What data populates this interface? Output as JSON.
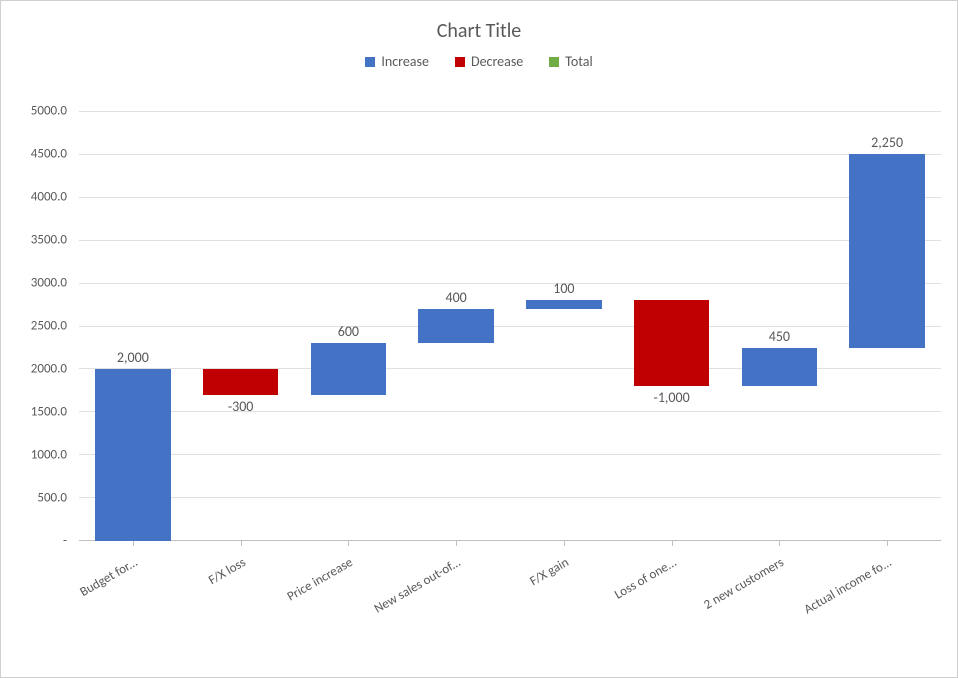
{
  "chart_data": {
    "type": "waterfall",
    "title": "Chart Title",
    "legend": [
      {
        "name": "Increase",
        "color": "#4472C4"
      },
      {
        "name": "Decrease",
        "color": "#C00000"
      },
      {
        "name": "Total",
        "color": "#70AD47"
      }
    ],
    "categories": [
      "Budget for...",
      "F/X loss",
      "Price increase",
      "New sales out-of...",
      "F/X gain",
      "Loss of one...",
      "2 new customers",
      "Actual income fo..."
    ],
    "data_labels": [
      "2,000",
      "-300",
      "600",
      "400",
      "100",
      "-1,000",
      "450",
      "2,250"
    ],
    "values": [
      2000,
      -300,
      600,
      400,
      100,
      -1000,
      450,
      2250
    ],
    "y_ticks": [
      "-",
      "500.0",
      "1000.0",
      "1500.0",
      "2000.0",
      "2500.0",
      "3000.0",
      "3500.0",
      "4000.0",
      "4500.0",
      "5000.0"
    ],
    "ylim": [
      0,
      5000
    ],
    "bars": [
      {
        "bottom": 0,
        "top": 2000,
        "class": "increase",
        "label_pos": "top"
      },
      {
        "bottom": 1700,
        "top": 2000,
        "class": "decrease",
        "label_pos": "bottom"
      },
      {
        "bottom": 1700,
        "top": 2300,
        "class": "increase",
        "label_pos": "top"
      },
      {
        "bottom": 2300,
        "top": 2700,
        "class": "increase",
        "label_pos": "top"
      },
      {
        "bottom": 2700,
        "top": 2800,
        "class": "increase",
        "label_pos": "top"
      },
      {
        "bottom": 1800,
        "top": 2800,
        "class": "decrease",
        "label_pos": "bottom"
      },
      {
        "bottom": 1800,
        "top": 2250,
        "class": "increase",
        "label_pos": "top"
      },
      {
        "bottom": 2250,
        "top": 4500,
        "class": "increase",
        "label_pos": "top"
      }
    ]
  }
}
